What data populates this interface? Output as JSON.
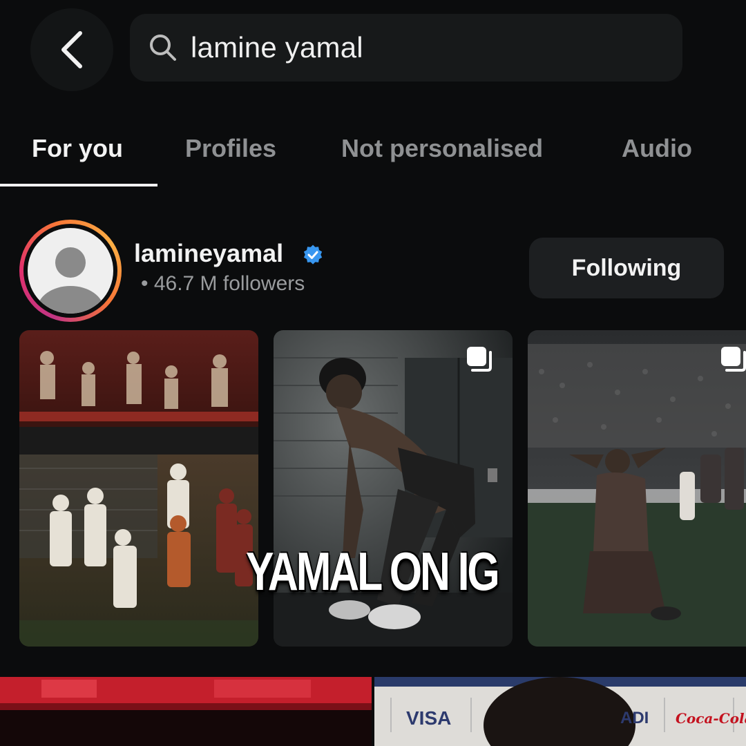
{
  "search": {
    "query": "lamine yamal"
  },
  "tabs": [
    {
      "label": "For you",
      "active": true
    },
    {
      "label": "Profiles",
      "active": false
    },
    {
      "label": "Not personalised",
      "active": false
    },
    {
      "label": "Audio",
      "active": false
    }
  ],
  "profile": {
    "username": "lamineyamal",
    "verified": true,
    "followers": "• 46.7 M followers",
    "follow_button": "Following",
    "ring_colors": [
      "#c13584",
      "#e1306c",
      "#f77737",
      "#fcaf45"
    ]
  },
  "overlay": {
    "caption": "YAMAL ON IG"
  },
  "bottom_posts": {
    "sponsors": [
      "VISA",
      "ADI",
      "Coca-Cola"
    ]
  },
  "colors": {
    "background": "#0b0c0d",
    "search_bg": "#17191a",
    "button_bg": "#1d1f21",
    "verified_blue": "#3897f0"
  },
  "icons": {
    "back": "chevron-left-icon",
    "search": "search-icon",
    "verified": "verified-badge-icon",
    "multi": "multiple-images-icon"
  }
}
